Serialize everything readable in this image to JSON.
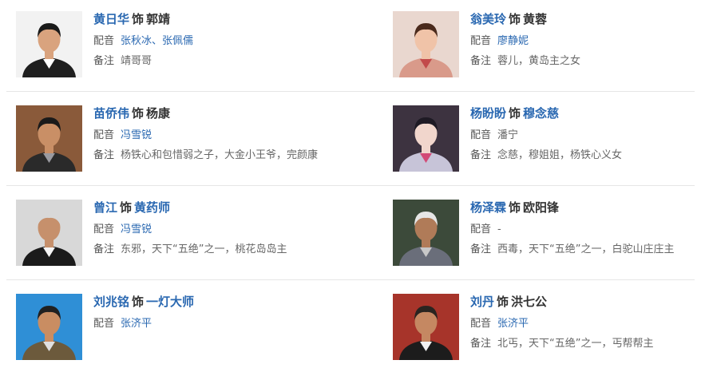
{
  "labels": {
    "role_connector": "饰",
    "dub": "配音",
    "note": "备注"
  },
  "cast": [
    {
      "actor": "黄日华",
      "role": "郭靖",
      "role_is_link": false,
      "dub": "张秋冰、张佩儒",
      "dub_is_link": true,
      "note": "靖哥哥",
      "photo_icon": "actor-portrait",
      "colors": {
        "bg": "#f2f2f2",
        "hair": "#1a1a1a",
        "skin": "#d9a37e",
        "cloth": "#1f1f1f",
        "accent": "#ffffff"
      }
    },
    {
      "actor": "翁美玲",
      "role": "黄蓉",
      "role_is_link": false,
      "dub": "廖静妮",
      "dub_is_link": true,
      "note": "蓉儿，黄岛主之女",
      "photo_icon": "actress-portrait",
      "colors": {
        "bg": "#e9d7cf",
        "hair": "#4a2a1c",
        "skin": "#f0c3a8",
        "cloth": "#d99a8a",
        "accent": "#c24a4a"
      }
    },
    {
      "actor": "苗侨伟",
      "role": "杨康",
      "role_is_link": false,
      "dub": "冯雪锐",
      "dub_is_link": true,
      "note": "杨铁心和包惜弱之子，大金小王爷，完颜康",
      "photo_icon": "actor-portrait",
      "colors": {
        "bg": "#8a5a3a",
        "hair": "#1a1a1a",
        "skin": "#c98f66",
        "cloth": "#2a2a2a",
        "accent": "#9a9aa0"
      }
    },
    {
      "actor": "杨盼盼",
      "role": "穆念慈",
      "role_is_link": true,
      "dub": "潘宁",
      "dub_is_link": false,
      "note": "念慈，穆姐姐，杨铁心义女",
      "photo_icon": "costume-actress-portrait",
      "colors": {
        "bg": "#3d3340",
        "hair": "#1e1a24",
        "skin": "#f1d6cc",
        "cloth": "#c7c4d8",
        "accent": "#d24a76"
      }
    },
    {
      "actor": "曾江",
      "role": "黄药师",
      "role_is_link": true,
      "dub": "冯雪锐",
      "dub_is_link": true,
      "note": "东邪，天下“五绝”之一，桃花岛岛主",
      "photo_icon": "elder-actor-portrait",
      "colors": {
        "bg": "#d8d8d8",
        "hair": "#d8d8d8",
        "skin": "#c6906c",
        "cloth": "#1b1b1b",
        "accent": "#f5f5f5"
      }
    },
    {
      "actor": "杨泽霖",
      "role": "欧阳锋",
      "role_is_link": false,
      "dub": "-",
      "dub_is_link": false,
      "note": "西毒，天下“五绝”之一，白驼山庄庄主",
      "photo_icon": "costume-actor-portrait",
      "colors": {
        "bg": "#3c4a3a",
        "hair": "#e6e6e6",
        "skin": "#b07b58",
        "cloth": "#6a6e7a",
        "accent": "#c8c8c8"
      }
    },
    {
      "actor": "刘兆铭",
      "role": "一灯大师",
      "role_is_link": true,
      "dub": "张济平",
      "dub_is_link": true,
      "note": "",
      "photo_icon": "actor-portrait",
      "colors": {
        "bg": "#2f8fd6",
        "hair": "#202020",
        "skin": "#c98d62",
        "cloth": "#6c5a3c",
        "accent": "#e0e0e0"
      }
    },
    {
      "actor": "刘丹",
      "role": "洪七公",
      "role_is_link": false,
      "dub": "张济平",
      "dub_is_link": true,
      "note": "北丐，天下“五绝”之一，丐帮帮主",
      "photo_icon": "actor-portrait",
      "colors": {
        "bg": "#a7342a",
        "hair": "#2a2420",
        "skin": "#c58862",
        "cloth": "#1c1c1c",
        "accent": "#f2f2f2"
      }
    }
  ]
}
